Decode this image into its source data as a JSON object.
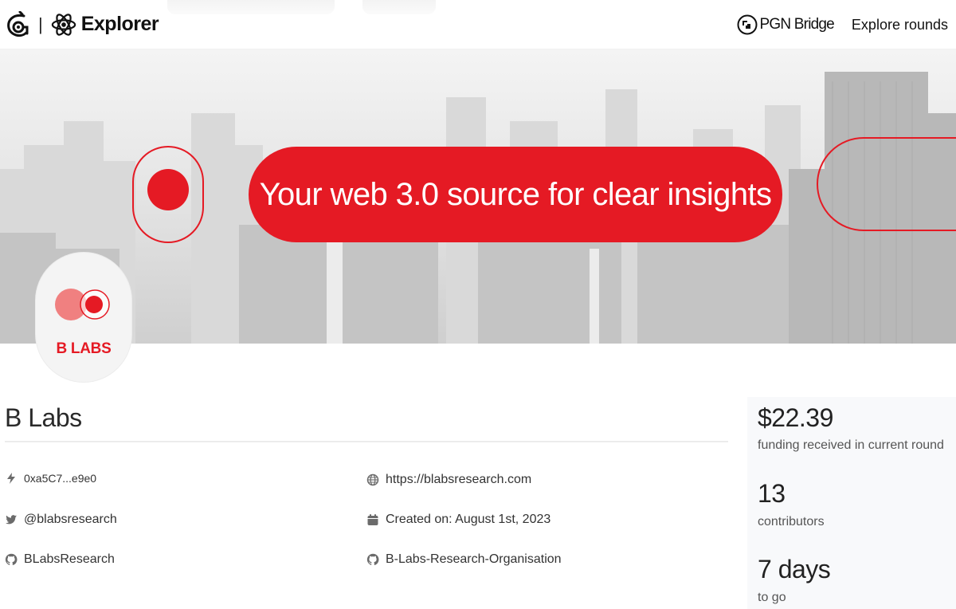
{
  "header": {
    "brand_name": "Explorer",
    "brand_separator": "|",
    "nav": {
      "pgn_bridge": "PGN Bridge",
      "explore_rounds": "Explore rounds"
    }
  },
  "banner": {
    "tagline": "Your web 3.0 source for clear insights",
    "accent_color": "#e51a24"
  },
  "project": {
    "logo_text": "B LABS",
    "name": "B Labs",
    "details": {
      "address": "0xa5C7...e9e0",
      "website": "https://blabsresearch.com",
      "twitter": "@blabsresearch",
      "created": "Created on: August 1st, 2023",
      "github_user": "BLabsResearch",
      "github_org": "B-Labs-Research-Organisation"
    },
    "icons": {
      "address": "bolt-icon",
      "website": "globe-icon",
      "twitter": "twitter-icon",
      "created": "calendar-icon",
      "github_user": "github-icon",
      "github_org": "github-icon"
    }
  },
  "stats": {
    "funding_value": "$22.39",
    "funding_label": "funding received in current round",
    "contributors_value": "13",
    "contributors_label": "contributors",
    "time_value": "7 days",
    "time_label": "to go"
  }
}
